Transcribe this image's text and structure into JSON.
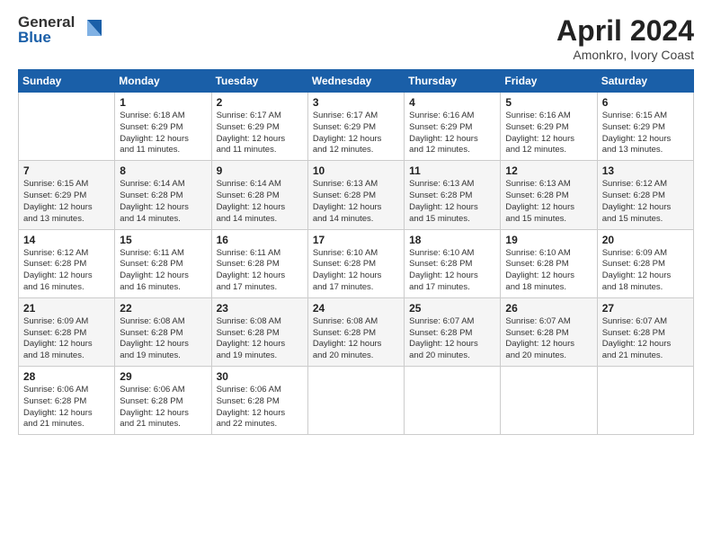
{
  "logo": {
    "general": "General",
    "blue": "Blue"
  },
  "title": {
    "month": "April 2024",
    "location": "Amonkro, Ivory Coast"
  },
  "weekdays": [
    "Sunday",
    "Monday",
    "Tuesday",
    "Wednesday",
    "Thursday",
    "Friday",
    "Saturday"
  ],
  "weeks": [
    [
      {
        "day": "",
        "info": ""
      },
      {
        "day": "1",
        "info": "Sunrise: 6:18 AM\nSunset: 6:29 PM\nDaylight: 12 hours\nand 11 minutes."
      },
      {
        "day": "2",
        "info": "Sunrise: 6:17 AM\nSunset: 6:29 PM\nDaylight: 12 hours\nand 11 minutes."
      },
      {
        "day": "3",
        "info": "Sunrise: 6:17 AM\nSunset: 6:29 PM\nDaylight: 12 hours\nand 12 minutes."
      },
      {
        "day": "4",
        "info": "Sunrise: 6:16 AM\nSunset: 6:29 PM\nDaylight: 12 hours\nand 12 minutes."
      },
      {
        "day": "5",
        "info": "Sunrise: 6:16 AM\nSunset: 6:29 PM\nDaylight: 12 hours\nand 12 minutes."
      },
      {
        "day": "6",
        "info": "Sunrise: 6:15 AM\nSunset: 6:29 PM\nDaylight: 12 hours\nand 13 minutes."
      }
    ],
    [
      {
        "day": "7",
        "info": "Sunrise: 6:15 AM\nSunset: 6:29 PM\nDaylight: 12 hours\nand 13 minutes."
      },
      {
        "day": "8",
        "info": "Sunrise: 6:14 AM\nSunset: 6:28 PM\nDaylight: 12 hours\nand 14 minutes."
      },
      {
        "day": "9",
        "info": "Sunrise: 6:14 AM\nSunset: 6:28 PM\nDaylight: 12 hours\nand 14 minutes."
      },
      {
        "day": "10",
        "info": "Sunrise: 6:13 AM\nSunset: 6:28 PM\nDaylight: 12 hours\nand 14 minutes."
      },
      {
        "day": "11",
        "info": "Sunrise: 6:13 AM\nSunset: 6:28 PM\nDaylight: 12 hours\nand 15 minutes."
      },
      {
        "day": "12",
        "info": "Sunrise: 6:13 AM\nSunset: 6:28 PM\nDaylight: 12 hours\nand 15 minutes."
      },
      {
        "day": "13",
        "info": "Sunrise: 6:12 AM\nSunset: 6:28 PM\nDaylight: 12 hours\nand 15 minutes."
      }
    ],
    [
      {
        "day": "14",
        "info": "Sunrise: 6:12 AM\nSunset: 6:28 PM\nDaylight: 12 hours\nand 16 minutes."
      },
      {
        "day": "15",
        "info": "Sunrise: 6:11 AM\nSunset: 6:28 PM\nDaylight: 12 hours\nand 16 minutes."
      },
      {
        "day": "16",
        "info": "Sunrise: 6:11 AM\nSunset: 6:28 PM\nDaylight: 12 hours\nand 17 minutes."
      },
      {
        "day": "17",
        "info": "Sunrise: 6:10 AM\nSunset: 6:28 PM\nDaylight: 12 hours\nand 17 minutes."
      },
      {
        "day": "18",
        "info": "Sunrise: 6:10 AM\nSunset: 6:28 PM\nDaylight: 12 hours\nand 17 minutes."
      },
      {
        "day": "19",
        "info": "Sunrise: 6:10 AM\nSunset: 6:28 PM\nDaylight: 12 hours\nand 18 minutes."
      },
      {
        "day": "20",
        "info": "Sunrise: 6:09 AM\nSunset: 6:28 PM\nDaylight: 12 hours\nand 18 minutes."
      }
    ],
    [
      {
        "day": "21",
        "info": "Sunrise: 6:09 AM\nSunset: 6:28 PM\nDaylight: 12 hours\nand 18 minutes."
      },
      {
        "day": "22",
        "info": "Sunrise: 6:08 AM\nSunset: 6:28 PM\nDaylight: 12 hours\nand 19 minutes."
      },
      {
        "day": "23",
        "info": "Sunrise: 6:08 AM\nSunset: 6:28 PM\nDaylight: 12 hours\nand 19 minutes."
      },
      {
        "day": "24",
        "info": "Sunrise: 6:08 AM\nSunset: 6:28 PM\nDaylight: 12 hours\nand 20 minutes."
      },
      {
        "day": "25",
        "info": "Sunrise: 6:07 AM\nSunset: 6:28 PM\nDaylight: 12 hours\nand 20 minutes."
      },
      {
        "day": "26",
        "info": "Sunrise: 6:07 AM\nSunset: 6:28 PM\nDaylight: 12 hours\nand 20 minutes."
      },
      {
        "day": "27",
        "info": "Sunrise: 6:07 AM\nSunset: 6:28 PM\nDaylight: 12 hours\nand 21 minutes."
      }
    ],
    [
      {
        "day": "28",
        "info": "Sunrise: 6:06 AM\nSunset: 6:28 PM\nDaylight: 12 hours\nand 21 minutes."
      },
      {
        "day": "29",
        "info": "Sunrise: 6:06 AM\nSunset: 6:28 PM\nDaylight: 12 hours\nand 21 minutes."
      },
      {
        "day": "30",
        "info": "Sunrise: 6:06 AM\nSunset: 6:28 PM\nDaylight: 12 hours\nand 22 minutes."
      },
      {
        "day": "",
        "info": ""
      },
      {
        "day": "",
        "info": ""
      },
      {
        "day": "",
        "info": ""
      },
      {
        "day": "",
        "info": ""
      }
    ]
  ]
}
